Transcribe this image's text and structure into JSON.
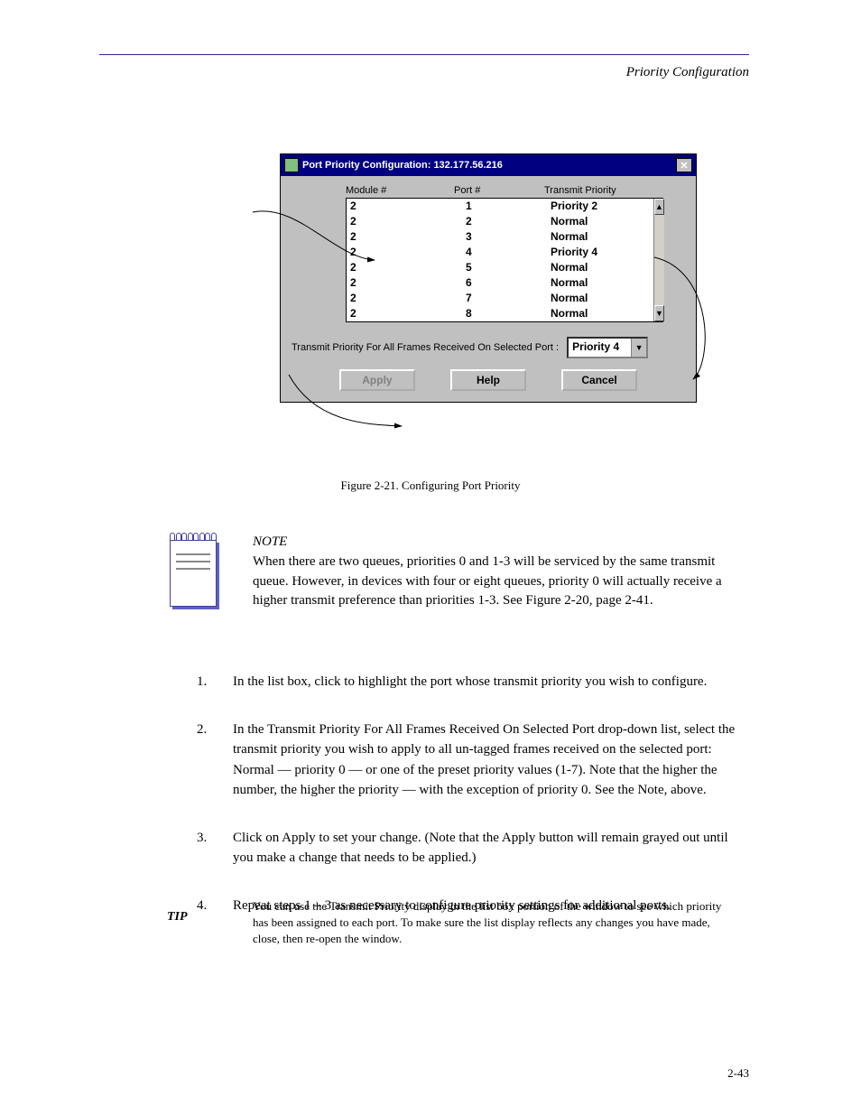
{
  "header_right": "Priority Configuration",
  "dialog": {
    "title": "Port Priority Configuration: 132.177.56.216",
    "cols": {
      "a": "Module #",
      "b": "Port #",
      "c": "Transmit Priority"
    },
    "rows": [
      {
        "m": "2",
        "p": "1",
        "t": "Priority 2"
      },
      {
        "m": "2",
        "p": "2",
        "t": "Normal"
      },
      {
        "m": "2",
        "p": "3",
        "t": "Normal"
      },
      {
        "m": "2",
        "p": "4",
        "t": "Priority 4"
      },
      {
        "m": "2",
        "p": "5",
        "t": "Normal"
      },
      {
        "m": "2",
        "p": "6",
        "t": "Normal"
      },
      {
        "m": "2",
        "p": "7",
        "t": "Normal"
      },
      {
        "m": "2",
        "p": "8",
        "t": "Normal"
      }
    ],
    "prompt": "Transmit Priority For All Frames Received On Selected Port :",
    "selected": "Priority 4",
    "buttons": {
      "apply": "Apply",
      "help": "Help",
      "cancel": "Cancel"
    }
  },
  "fig_caption_prefix": "Figure 2-21. ",
  "fig_caption": "Configuring Port Priority",
  "note_label": "NOTE",
  "note_body": "When there are two queues, priorities 0 and 1-3 will be serviced by the same transmit queue. However, in devices with four or eight queues, priority 0 will actually receive a higher transmit preference than priorities 1-3. See Figure 2-20, page 2-41.",
  "steps": [
    {
      "n": "1.",
      "t": "In the list box, click to highlight the port whose transmit priority you wish to configure."
    },
    {
      "n": "2.",
      "t": "In the Transmit Priority For All Frames Received On Selected Port drop-down list, select the transmit priority you wish to apply to all un-tagged frames received on the selected port: Normal — priority 0 — or one of the preset priority values (1-7). Note that the higher the number, the higher the priority — with the exception of priority 0. See the Note, above."
    },
    {
      "n": "3.",
      "t": "Click on Apply to set your change. (Note that the Apply button will remain grayed out until you make a change that needs to be applied.)"
    },
    {
      "n": "4.",
      "t": "Repeat steps 1 – 3 as necessary to configure priority settings for additional ports."
    }
  ],
  "hint_label": "TIP",
  "hint_body": "You can use the Transmit Priority display in the list box portion of the window to see which priority has been assigned to each port. To make sure the list display reflects any changes you have made, close, then re-open the window.",
  "pagenum": "2-43"
}
